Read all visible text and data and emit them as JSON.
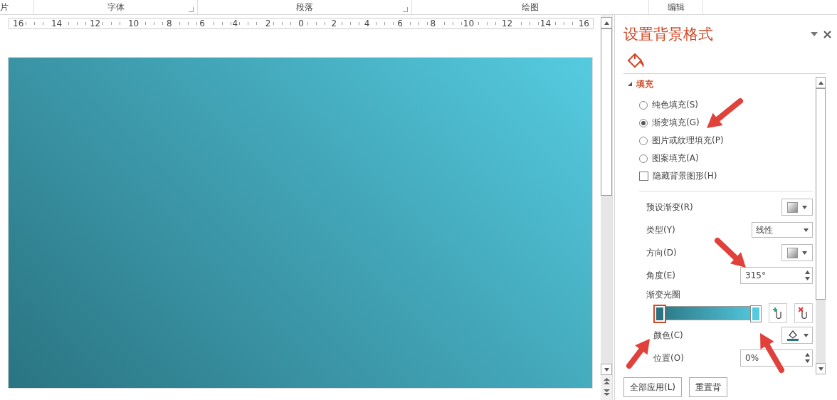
{
  "ribbon": {
    "groups": [
      {
        "label": "片",
        "launcher": false
      },
      {
        "label": "字体",
        "launcher": true
      },
      {
        "label": "段落",
        "launcher": true
      },
      {
        "label": "绘图",
        "launcher": false
      },
      {
        "label": "编辑",
        "launcher": false
      }
    ]
  },
  "ruler": {
    "ticks": [
      "16",
      "14",
      "12",
      "10",
      "8",
      "6",
      "4",
      "2",
      "0",
      "2",
      "4",
      "6",
      "8",
      "10",
      "12",
      "14",
      "16"
    ]
  },
  "panel": {
    "title": "设置背景格式",
    "section": {
      "title": "填充",
      "expanded": true
    },
    "fill_options": [
      {
        "label": "纯色填充(S)",
        "selected": false
      },
      {
        "label": "渐变填充(G)",
        "selected": true
      },
      {
        "label": "图片或纹理填充(P)",
        "selected": false
      },
      {
        "label": "图案填充(A)",
        "selected": false
      }
    ],
    "hide_graphics": {
      "label": "隐藏背景图形(H)",
      "checked": false
    },
    "rows": [
      {
        "kind": "swatch",
        "label": "预设渐变(R)"
      },
      {
        "kind": "dropdown",
        "label": "类型(Y)",
        "value": "线性"
      },
      {
        "kind": "swatch",
        "label": "方向(D)"
      },
      {
        "kind": "spinner",
        "label": "角度(E)",
        "value": "315°"
      }
    ],
    "stops_label": "渐变光圈",
    "stops": [
      {
        "level": 0,
        "color": "#2a7482",
        "selected": true
      },
      {
        "level": 1,
        "color": "#55cbe0",
        "selected": false
      }
    ],
    "color_label": "颜色(C)",
    "position": {
      "label": "位置(O)",
      "value": "0%"
    },
    "buttons": [
      "全部应用(L)",
      "重置背"
    ]
  }
}
